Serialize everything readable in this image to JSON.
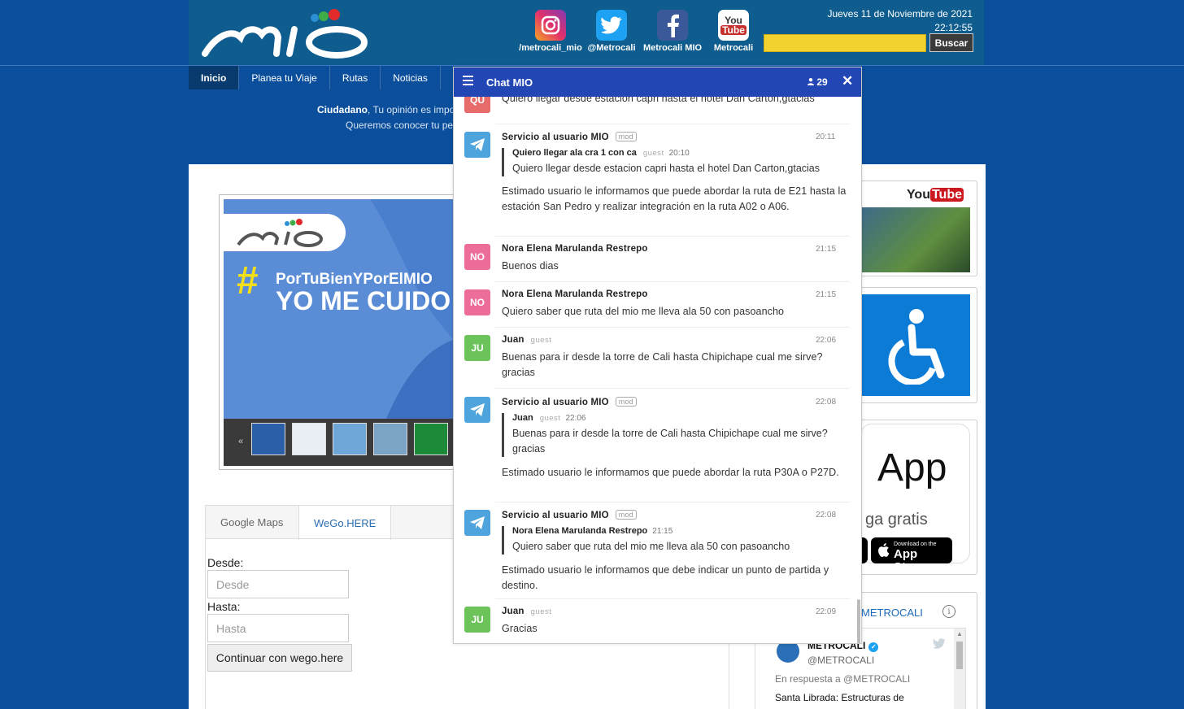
{
  "header": {
    "social": [
      {
        "icon": "instagram-icon",
        "label": "/metrocali_mio"
      },
      {
        "icon": "twitter-icon",
        "label": "@Metrocali"
      },
      {
        "icon": "facebook-icon",
        "label": "Metrocali MIO"
      },
      {
        "icon": "youtube-icon",
        "label": "Metrocali",
        "glyph_top": "You",
        "glyph_bottom": "Tube"
      }
    ],
    "date": "Jueves 11 de Noviembre de  2021",
    "time": "22:12:55",
    "search_button": "Buscar"
  },
  "nav": {
    "items": [
      "Inicio",
      "Planea tu Viaje",
      "Rutas",
      "Noticias"
    ]
  },
  "banner": {
    "bold": "Ciudadano",
    "line1": ", Tu opinión es impo",
    "line2": "Queremos conocer tu pe"
  },
  "slider": {
    "hashtag": "#",
    "line1": "PorTuBienYPorElMIO",
    "line2": "YO ME CUIDO",
    "prev_arrow": "«"
  },
  "map_tabs": [
    "Google Maps",
    "WeGo.HERE"
  ],
  "route_form": {
    "from_label": "Desde:",
    "from_placeholder": "Desde",
    "to_label": "Hasta:",
    "to_placeholder": "Hasta",
    "submit": "Continuar con wego.here"
  },
  "sidebar": {
    "youtube_logo": "You",
    "youtube_tube": "Tube",
    "app_title": "App",
    "app_sub": "ga gratis",
    "appstore_small": "Download on the",
    "appstore_big": "App Store",
    "twitter_title": "METROCALI",
    "info": "i"
  },
  "tweet": {
    "name": "METROCALI",
    "handle": "@METROCALI",
    "reply": "En respuesta a @METROCALI",
    "text": "Santa Librada: Estructuras de"
  },
  "chat": {
    "title": "Chat MIO",
    "users_count": "29",
    "close": "✕",
    "messages": [
      {
        "avatar": "QU",
        "text": "Quiero llegar desde estacion capri hasta el hotel Dan Carton,gtacias"
      },
      {
        "name": "Servicio al usuario MIO",
        "badge": "mod",
        "time": "20:11",
        "quote_name": "Quiero llegar ala cra 1 con ca",
        "quote_role": "guest",
        "quote_time": "20:10",
        "quote_text": "Quiero llegar desde estacion capri hasta el hotel Dan Carton,gtacias",
        "text": "Estimado usuario le informamos que puede abordar la ruta de E21 hasta la estación San Pedro y realizar integración en la ruta A02 o A06."
      },
      {
        "avatar": "NO",
        "name": "Nora Elena Marulanda Restrepo",
        "time": "21:15",
        "text": "Buenos dias"
      },
      {
        "avatar": "NO",
        "name": "Nora Elena Marulanda Restrepo",
        "time": "21:15",
        "text": "Quiero saber que ruta del mio me lleva ala 50 con pasoancho"
      },
      {
        "avatar": "JU",
        "name": "Juan",
        "role": "guest",
        "time": "22:06",
        "text": "Buenas para ir desde la torre de Cali hasta Chipichape cual me sirve? gracias"
      },
      {
        "name": "Servicio al usuario MIO",
        "badge": "mod",
        "time": "22:08",
        "quote_name": "Juan",
        "quote_role": "guest",
        "quote_time": "22:06",
        "quote_text": "Buenas para ir desde la torre de Cali hasta Chipichape cual me sirve? gracias",
        "text": "Estimado usuario le informamos que puede abordar la ruta P30A o P27D."
      },
      {
        "name": "Servicio al usuario MIO",
        "badge": "mod",
        "time": "22:08",
        "quote_name": "Nora Elena Marulanda Restrepo",
        "quote_time": "21:15",
        "quote_text": "Quiero saber que ruta del mio me lleva ala 50 con pasoancho",
        "text": "Estimado usuario le informamos que debe indicar un punto de partida y destino."
      },
      {
        "avatar": "JU",
        "name": "Juan",
        "role": "guest",
        "time": "22:09",
        "text": "Gracias"
      }
    ]
  },
  "colors": {
    "page_bg": "#0b4f9c",
    "header_bg": "#0e5d8e",
    "chat_header": "#2247b5",
    "search_yellow": "#f2d22e"
  }
}
